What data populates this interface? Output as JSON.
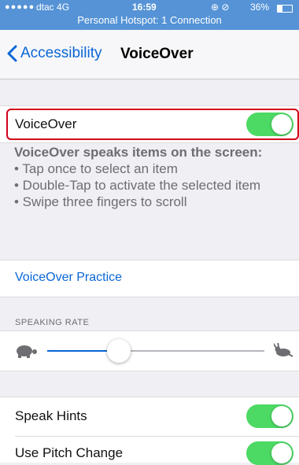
{
  "status_bar": {
    "signal": "●●●●●",
    "carrier": "dtac",
    "network": "4G",
    "time": "16:59",
    "indicators": "⊕ ⊘",
    "battery_percent": "36%",
    "battery_level": 0.36,
    "hotspot": "Personal Hotspot: 1 Connection"
  },
  "nav": {
    "back_label": "Accessibility",
    "title": "VoiceOver"
  },
  "voiceover": {
    "label": "VoiceOver",
    "enabled": true
  },
  "description": {
    "lead": "VoiceOver speaks items on the screen:",
    "bullets": [
      "• Tap once to select an item",
      "• Double-Tap to activate the selected item",
      "• Swipe three fingers to scroll"
    ]
  },
  "practice": {
    "label": "VoiceOver Practice"
  },
  "speaking_rate": {
    "header": "SPEAKING RATE",
    "value": 0.33,
    "slow_icon": "turtle-icon",
    "fast_icon": "hare-icon"
  },
  "settings": [
    {
      "label": "Speak Hints",
      "enabled": true
    },
    {
      "label": "Use Pitch Change",
      "enabled": true
    }
  ],
  "colors": {
    "status_bar": "#5593d6",
    "accent": "#0a66d6",
    "switch_on": "#4cd964",
    "highlight_border": "#d0021b"
  }
}
